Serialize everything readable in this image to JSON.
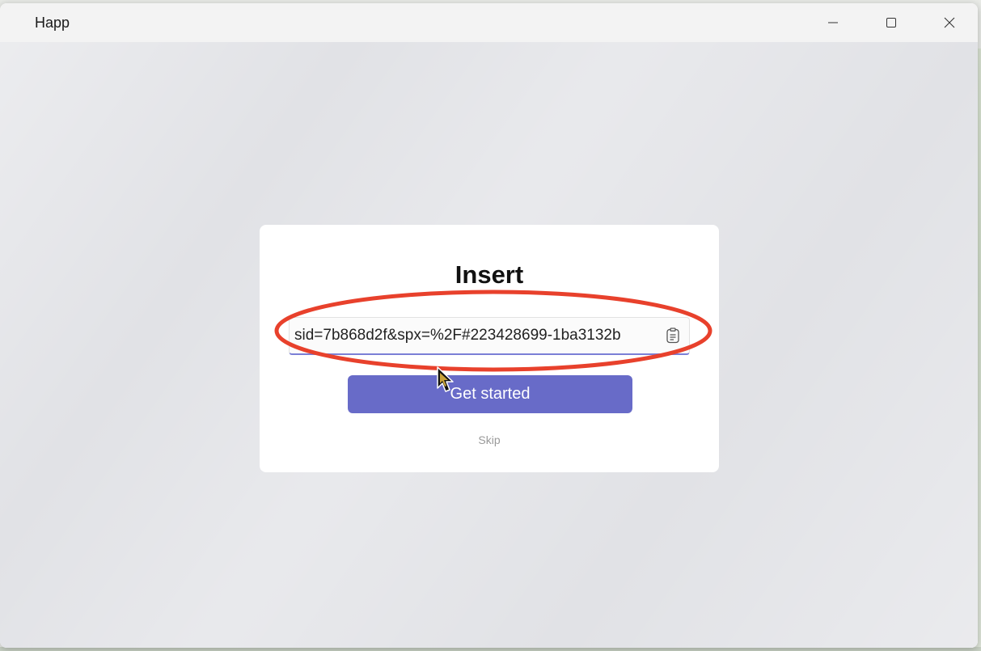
{
  "window": {
    "title": "Happ",
    "controls": {
      "minimize_icon": "minimize-icon",
      "maximize_icon": "maximize-icon",
      "close_icon": "close-icon"
    }
  },
  "dialog": {
    "title": "Insert",
    "input": {
      "value": "sid=7b868d2f&spx=%2F#223428699-1ba3132b",
      "paste_icon": "clipboard-icon"
    },
    "primary_button": "Get started",
    "skip_link": "Skip"
  },
  "colors": {
    "accent": "#686bc8",
    "input_underline": "#7b7fd6",
    "annotation": "#e8412c",
    "background": "#e1e2e6"
  }
}
